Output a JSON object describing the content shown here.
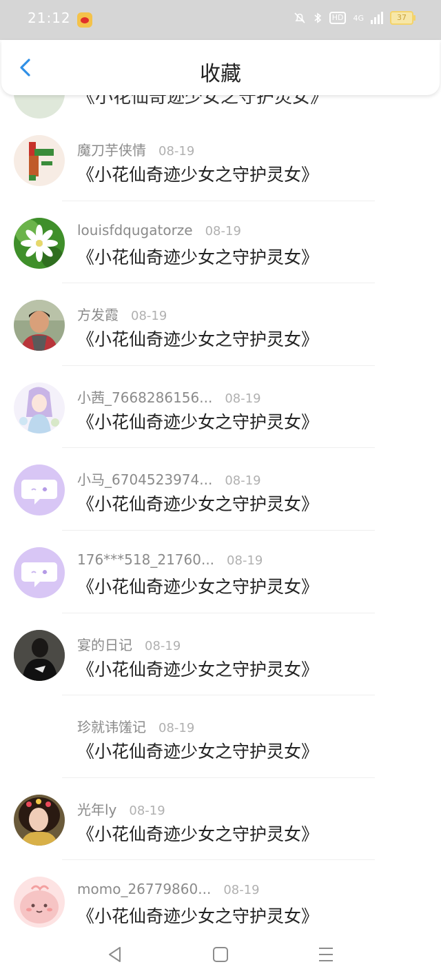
{
  "status_bar": {
    "time": "21:12",
    "battery": "37",
    "hd": "HD",
    "network": "4G"
  },
  "header": {
    "title": "收藏"
  },
  "partial_item": {
    "message": "《小花仙奇迹少女之守护灵女》"
  },
  "items": [
    {
      "name": "魔刀芋侠情",
      "date": "08-19",
      "message": "《小花仙奇迹少女之守护灵女》",
      "avatar": "cartoon-figure"
    },
    {
      "name": "louisfdqugatorze",
      "date": "08-19",
      "message": "《小花仙奇迹少女之守护灵女》",
      "avatar": "flower"
    },
    {
      "name": "方发霞",
      "date": "08-19",
      "message": "《小花仙奇迹少女之守护灵女》",
      "avatar": "child-photo"
    },
    {
      "name": "小茜_7668286156...",
      "date": "08-19",
      "message": "《小花仙奇迹少女之守护灵女》",
      "avatar": "anime-girl"
    },
    {
      "name": "小马_6704523974...",
      "date": "08-19",
      "message": "《小花仙奇迹少女之守护灵女》",
      "avatar": "default-chat"
    },
    {
      "name": "176***518_21760...",
      "date": "08-19",
      "message": "《小花仙奇迹少女之守护灵女》",
      "avatar": "default-chat"
    },
    {
      "name": "宴的日记",
      "date": "08-19",
      "message": "《小花仙奇迹少女之守护灵女》",
      "avatar": "dark-photo"
    },
    {
      "name": "珍就讳馐记",
      "date": "08-19",
      "message": "《小花仙奇迹少女之守护灵女》",
      "avatar": "none"
    },
    {
      "name": "光年ly",
      "date": "08-19",
      "message": "《小花仙奇迹少女之守护灵女》",
      "avatar": "girl-photo"
    },
    {
      "name": "momo_26779860...",
      "date": "08-19",
      "message": "《小花仙奇迹少女之守护灵女》",
      "avatar": "pink-character"
    }
  ],
  "colors": {
    "accent": "#2f8fe6",
    "status_bar": "#d6d6d6",
    "chat_avatar_bg": "#d8c6f5"
  }
}
